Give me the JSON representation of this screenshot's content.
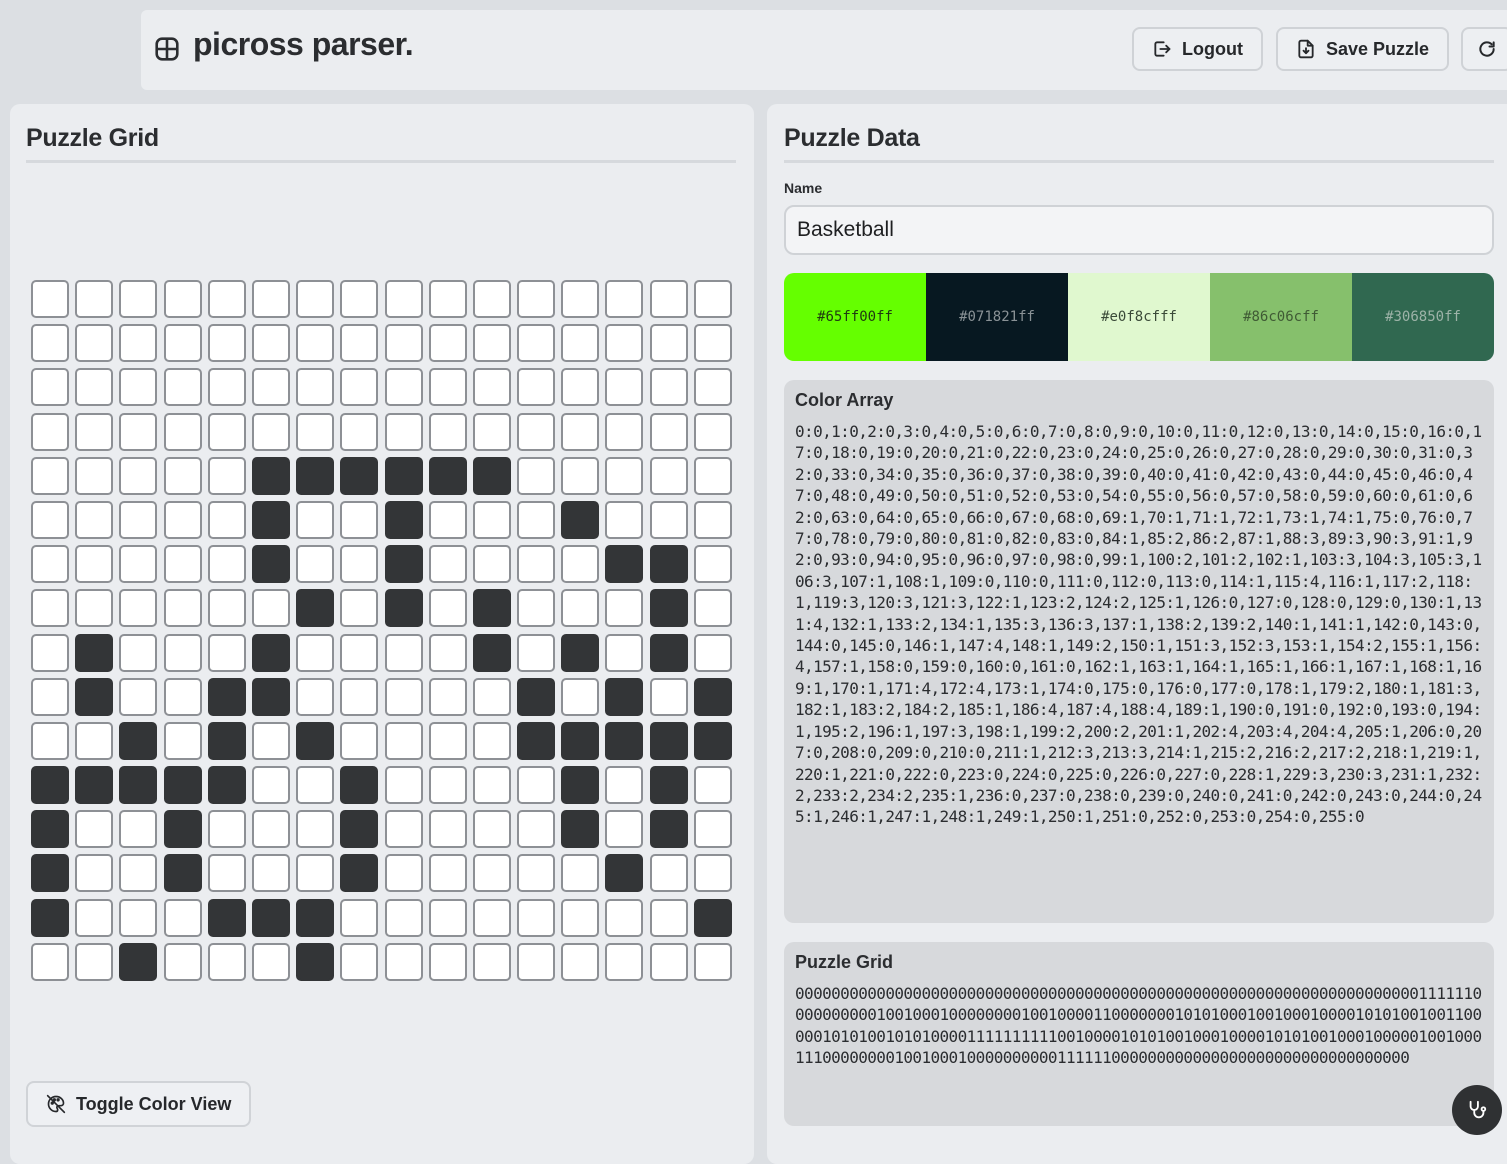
{
  "header": {
    "title": "picross parser.",
    "logout_label": "Logout",
    "save_label": "Save Puzzle"
  },
  "left_panel": {
    "title": "Puzzle Grid",
    "toggle_label": "Toggle Color View"
  },
  "grid": {
    "rows": 16,
    "cols": 16,
    "cells": "00000000000000000000000000000000000000000000000000000000000000000000011111100000000001001000100000000100100001100000001010100010010001000010101001001100000101010010101000011111111110010000101010010001000010101001000100000100100011100000000100100010000000000111111000000000000000000000000000000000"
  },
  "right_panel": {
    "title": "Puzzle Data",
    "name_label": "Name",
    "name_value": "Basketball",
    "palette": [
      {
        "hex": "#65ff00ff",
        "color": "#65ff00",
        "text_color": "#1f3a10"
      },
      {
        "hex": "#071821ff",
        "color": "#071821",
        "text_color": "#8a9296"
      },
      {
        "hex": "#e0f8cfff",
        "color": "#e0f8cf",
        "text_color": "#3a4a38"
      },
      {
        "hex": "#86c06cff",
        "color": "#86c06c",
        "text_color": "#3f5a34"
      },
      {
        "hex": "#306850ff",
        "color": "#306850",
        "text_color": "#9db3a8"
      }
    ],
    "color_array": {
      "title": "Color Array",
      "value": "0:0,1:0,2:0,3:0,4:0,5:0,6:0,7:0,8:0,9:0,10:0,11:0,12:0,13:0,14:0,15:0,16:0,17:0,18:0,19:0,20:0,21:0,22:0,23:0,24:0,25:0,26:0,27:0,28:0,29:0,30:0,31:0,32:0,33:0,34:0,35:0,36:0,37:0,38:0,39:0,40:0,41:0,42:0,43:0,44:0,45:0,46:0,47:0,48:0,49:0,50:0,51:0,52:0,53:0,54:0,55:0,56:0,57:0,58:0,59:0,60:0,61:0,62:0,63:0,64:0,65:0,66:0,67:0,68:0,69:1,70:1,71:1,72:1,73:1,74:1,75:0,76:0,77:0,78:0,79:0,80:0,81:0,82:0,83:0,84:1,85:2,86:2,87:1,88:3,89:3,90:3,91:1,92:0,93:0,94:0,95:0,96:0,97:0,98:0,99:1,100:2,101:2,102:1,103:3,104:3,105:3,106:3,107:1,108:1,109:0,110:0,111:0,112:0,113:0,114:1,115:4,116:1,117:2,118:1,119:3,120:3,121:3,122:1,123:2,124:2,125:1,126:0,127:0,128:0,129:0,130:1,131:4,132:1,133:2,134:1,135:3,136:3,137:1,138:2,139:2,140:1,141:1,142:0,143:0,144:0,145:0,146:1,147:4,148:1,149:2,150:1,151:3,152:3,153:1,154:2,155:1,156:4,157:1,158:0,159:0,160:0,161:0,162:1,163:1,164:1,165:1,166:1,167:1,168:1,169:1,170:1,171:4,172:4,173:1,174:0,175:0,176:0,177:0,178:1,179:2,180:1,181:3,182:1,183:2,184:2,185:1,186:4,187:4,188:4,189:1,190:0,191:0,192:0,193:0,194:1,195:2,196:1,197:3,198:1,199:2,200:2,201:1,202:4,203:4,204:4,205:1,206:0,207:0,208:0,209:0,210:0,211:1,212:3,213:3,214:1,215:2,216:2,217:2,218:1,219:1,220:1,221:0,222:0,223:0,224:0,225:0,226:0,227:0,228:1,229:3,230:3,231:1,232:2,233:2,234:2,235:1,236:0,237:0,238:0,239:0,240:0,241:0,242:0,243:0,244:0,245:1,246:1,247:1,248:1,249:1,250:1,251:0,252:0,253:0,254:0,255:0"
    },
    "puzzle_grid": {
      "title": "Puzzle Grid",
      "value": "00000000000000000000000000000000000000000000000000000000000000000000011111100000000001001000100000000100100001100000001010100010010001000010101001001100000101010010101000011111111110010000101010010001000010101001000100000100100011100000000100100010000000000111111000000000000000000000000000000000"
    }
  }
}
